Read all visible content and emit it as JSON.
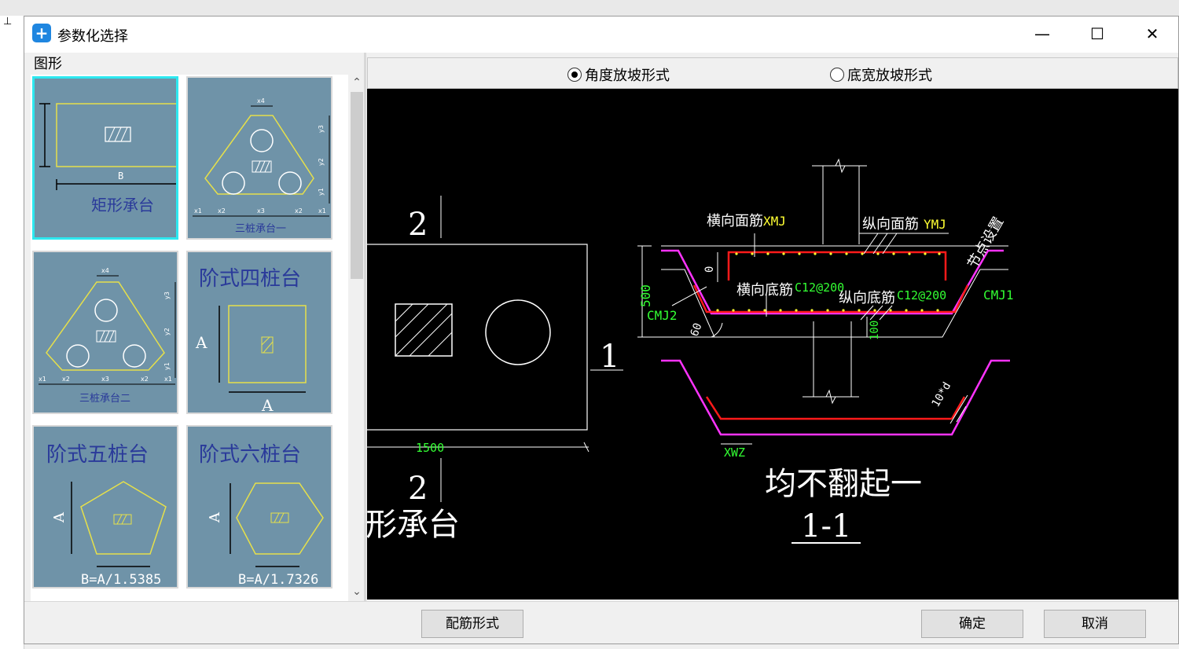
{
  "window": {
    "title": "参数化选择",
    "icon": "app-parametric-icon",
    "minimize": "—",
    "maximize": "☐",
    "close": "✕"
  },
  "left_panel": {
    "label": "图形",
    "shapes": [
      {
        "name": "矩形承台",
        "dims": [
          "B"
        ],
        "selected": true
      },
      {
        "name": "三桩承台一",
        "dims": [
          "x4",
          "y3",
          "y2",
          "y1",
          "x1",
          "x2",
          "x3",
          "x2",
          "x1"
        ]
      },
      {
        "name": "三桩承台二",
        "dims": [
          "x4",
          "y3",
          "y2",
          "y1",
          "x1",
          "x2",
          "x3",
          "x2",
          "x1"
        ]
      },
      {
        "name": "阶式四桩台",
        "dims": [
          "A",
          "A"
        ]
      },
      {
        "name": "阶式五桩台",
        "dims": [
          "A",
          "B=A/1.5385"
        ]
      },
      {
        "name": "阶式六桩台",
        "dims": [
          "A",
          "B=A/1.7326"
        ]
      }
    ]
  },
  "radio_options": [
    {
      "label": "角度放坡形式",
      "checked": true
    },
    {
      "label": "底宽放坡形式",
      "checked": false
    }
  ],
  "drawing": {
    "left": {
      "section_mark_top": "2",
      "section_mark_bottom": "2",
      "section_mark_right": "1",
      "dimension": "1500",
      "title": "形承台"
    },
    "right": {
      "horizontal_top_bar": "横向面筋",
      "horizontal_top_code": "XMJ",
      "vertical_top_bar": "纵向面筋",
      "vertical_top_code": "YMJ",
      "corner_note": "节点设置",
      "zero": "0",
      "height": "500",
      "horizontal_bottom_bar": "横向底筋",
      "horizontal_bottom_spec": "C12@200",
      "vertical_bottom_bar": "纵向底筋",
      "vertical_bottom_spec": "C12@200",
      "cmj1": "CMJ1",
      "cmj2": "CMJ2",
      "angle": "60",
      "cover": "100",
      "anchor": "10*d",
      "xwz": "XWZ",
      "title": "均不翻起一",
      "section": "1-1"
    }
  },
  "buttons": {
    "rebar_form": "配筋形式",
    "ok": "确定",
    "cancel": "取消"
  },
  "colors": {
    "canvas_bg": "#000000",
    "thumb_bg": "#6f93a8",
    "selected_border": "#2de8f0",
    "rebar_red": "#ff1a1a",
    "rebar_magenta": "#ff33ff",
    "dim_green": "#33ff33",
    "label_yellow": "#ffff33"
  }
}
